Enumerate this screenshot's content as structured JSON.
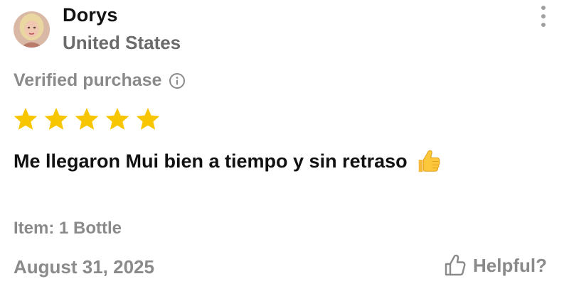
{
  "reviewer": {
    "name": "Dorys",
    "country": "United States",
    "avatar_icon": "user-avatar-photo"
  },
  "menu": {
    "icon": "more-vertical-icon"
  },
  "verified": {
    "label": "Verified purchase",
    "icon": "info-icon"
  },
  "rating": {
    "value": 5,
    "max": 5,
    "color": "#f7c600"
  },
  "review": {
    "text": "Me llegaron Mui bien a tiempo y sin retraso",
    "emoji": "thumbs-up-emoji"
  },
  "item": {
    "text": "Item: 1 Bottle"
  },
  "date": "August 31, 2025",
  "helpful": {
    "label": "Helpful?",
    "icon": "thumbs-up-outline-icon"
  },
  "colors": {
    "primary_text": "#111111",
    "secondary_text": "#8a8a8a",
    "star": "#f7c600"
  }
}
